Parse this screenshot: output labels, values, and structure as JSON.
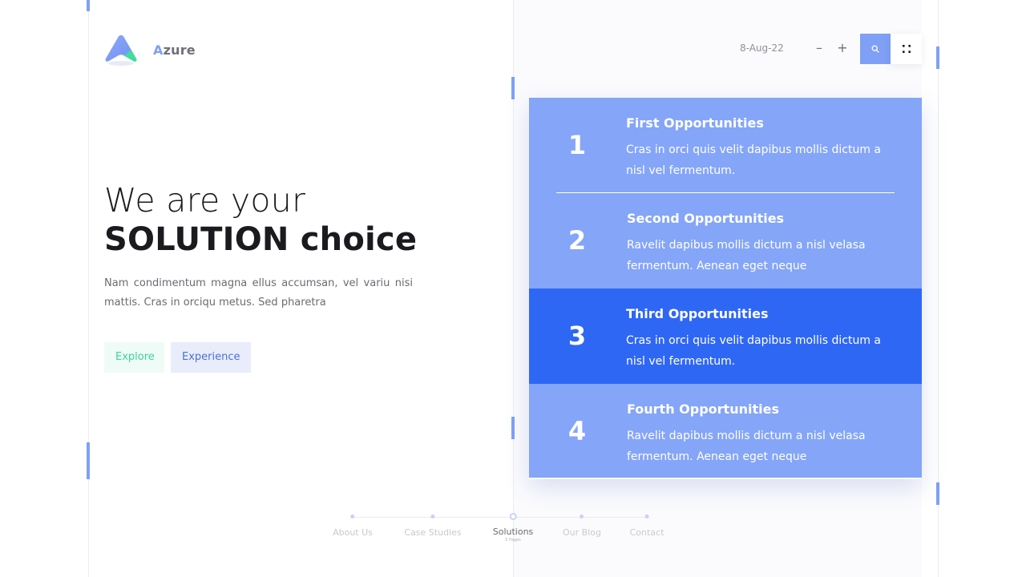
{
  "brand": {
    "initial": "A",
    "rest": "zure"
  },
  "hero": {
    "line1": "We are your",
    "line2": "SOLUTION choice",
    "description": "Nam condimentum  magna ellus accumsan, vel variu nisi mattis. Cras in orciqu metus. Sed pharetra"
  },
  "buttons": {
    "explore": "Explore",
    "experience": "Experience"
  },
  "controls": {
    "date": "8-Aug-22",
    "zoom_out": "–",
    "zoom_in": "+"
  },
  "icons": {
    "logo": "azure-logo-icon",
    "search": "search-icon",
    "menu": "grid-dots-icon"
  },
  "colors": {
    "accent": "#7fa0f6",
    "active": "#2f67f5",
    "card": "#84a5f8",
    "green": "#3bd49c"
  },
  "opportunities": [
    {
      "num": "1",
      "title": "First Opportunities",
      "desc": "Cras in orci quis velit dapibus mollis dictum a nisl vel fermentum."
    },
    {
      "num": "2",
      "title": "Second Opportunities",
      "desc": "Ravelit dapibus mollis dictum a nisl velasa fermentum. Aenean eget neque"
    },
    {
      "num": "3",
      "title": "Third Opportunities",
      "desc": "Cras in orci quis velit dapibus mollis dictum a nisl vel fermentum."
    },
    {
      "num": "4",
      "title": "Fourth Opportunities",
      "desc": "Ravelit dapibus mollis dictum a nisl velasa fermentum. Aenean eget neque"
    }
  ],
  "bottom_nav": [
    {
      "label": "About Us"
    },
    {
      "label": "Case Studies"
    },
    {
      "label": "Solutions",
      "sub": "5 Pages",
      "active": true
    },
    {
      "label": "Our Blog"
    },
    {
      "label": "Contact"
    }
  ]
}
